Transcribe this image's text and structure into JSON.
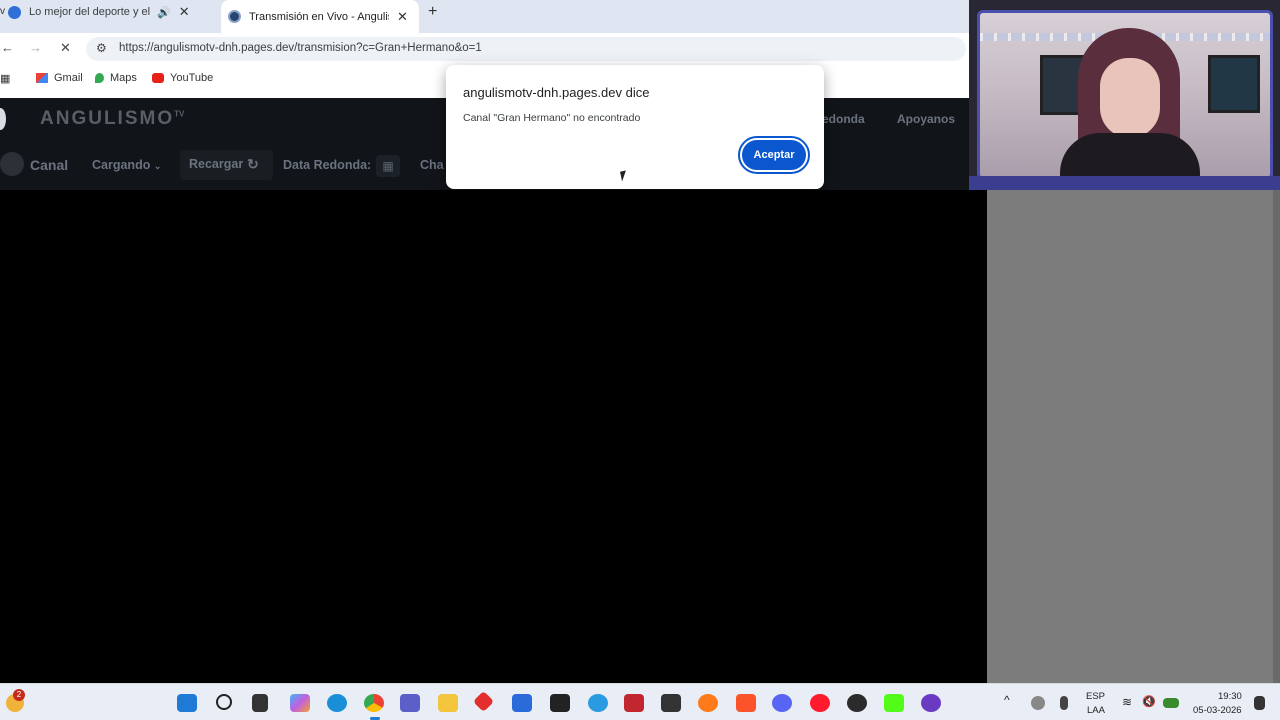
{
  "browser": {
    "left_tab_indicator": "v",
    "tabs": [
      {
        "title": "Lo mejor del deporte y el e",
        "audio_icon": "speaker-icon",
        "active": false
      },
      {
        "title": "Transmisión en Vivo - Angulism",
        "active": true
      }
    ],
    "new_tab": "+",
    "url": "https://angulismotv-dnh.pages.dev/transmision?c=Gran+Hermano&o=1",
    "bookmarks": [
      "Gmail",
      "Maps",
      "YouTube"
    ],
    "colors": {
      "tabbar": "#dfe6f1",
      "dialog_button": "#0b57d0"
    }
  },
  "site": {
    "logo": "ANGULISMO",
    "logo_sup": "TV",
    "nav_right": [
      "edonda",
      "Apoyanos"
    ],
    "controls": {
      "canal_label": "Canal",
      "channel_select": "Cargando",
      "reload_label": "Recargar",
      "data_label": "Data Redonda:",
      "chat_label": "Cha"
    }
  },
  "dialog": {
    "title": "angulismotv-dnh.pages.dev dice",
    "message": "Canal \"Gran Hermano\" no encontrado",
    "button": "Aceptar"
  },
  "taskbar": {
    "notification_count": "2",
    "language": "ESP",
    "layout": "LAA",
    "time": "19:30",
    "date": "05-03-2026"
  }
}
